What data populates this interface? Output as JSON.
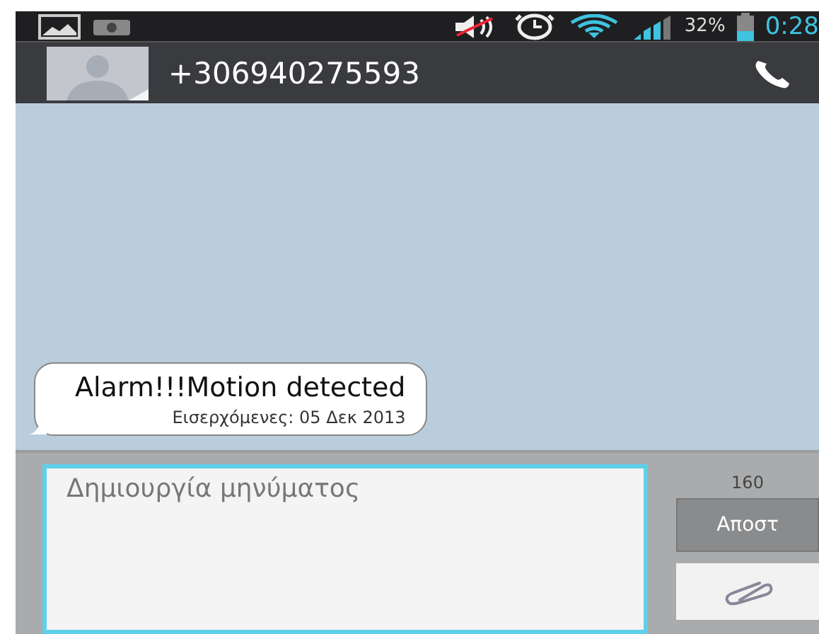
{
  "status_bar": {
    "battery": "32%",
    "time": "0:28"
  },
  "contact": {
    "number": "+306940275593"
  },
  "messages": [
    {
      "kind": "incoming",
      "text": "Alarm!!!Motion detected",
      "meta": "Εισερχόμενες: 05 Δεκ 2013"
    }
  ],
  "compose": {
    "placeholder": "Δημιουργία μηνύματος",
    "counter": "160",
    "send": "Αποστ"
  }
}
